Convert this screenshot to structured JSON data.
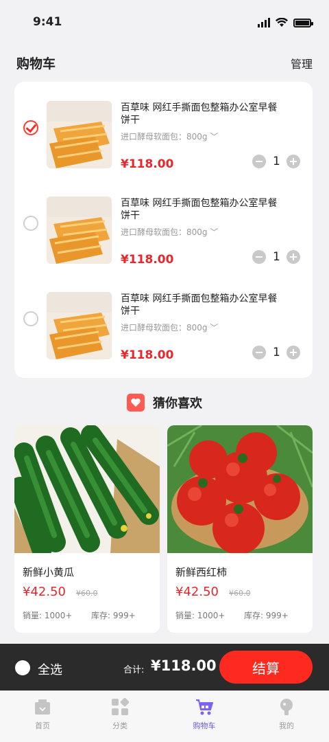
{
  "status_bar": {
    "time": "9:41"
  },
  "header": {
    "title": "购物车",
    "manage_label": "管理"
  },
  "cart": {
    "items": [
      {
        "checked": true,
        "name": "百草味 网红手撕面包整箱办公室早餐饼干",
        "spec": "进口酵母软面包：800g ﹀",
        "price": "¥118.00",
        "qty": "1"
      },
      {
        "checked": false,
        "name": "百草味 网红手撕面包整箱办公室早餐饼干",
        "spec": "进口酵母软面包：800g ﹀",
        "price": "¥118.00",
        "qty": "1"
      },
      {
        "checked": false,
        "name": "百草味 网红手撕面包整箱办公室早餐饼干",
        "spec": "进口酵母软面包：800g ﹀",
        "price": "¥118.00",
        "qty": "1"
      }
    ]
  },
  "recommend": {
    "title": "猜你喜欢",
    "icon": "heart-icon",
    "products": [
      {
        "name": "新鲜小黄瓜",
        "price": "¥42.50",
        "old_price": "¥60.0",
        "sales": "销量: 1000+",
        "stock": "库存: 999+"
      },
      {
        "name": "新鲜西红柿",
        "price": "¥42.50",
        "old_price": "¥60.0",
        "sales": "销量: 1000+",
        "stock": "库存: 999+"
      }
    ]
  },
  "checkout": {
    "select_all_label": "全选",
    "total_label": "合计:",
    "total_value": "¥118.00",
    "pay_label": "结算"
  },
  "tabbar": {
    "items": [
      {
        "label": "首页",
        "icon": "home-icon",
        "active": false
      },
      {
        "label": "分类",
        "icon": "category-icon",
        "active": false
      },
      {
        "label": "购物车",
        "icon": "cart-icon",
        "active": true
      },
      {
        "label": "我的",
        "icon": "profile-icon",
        "active": false
      }
    ]
  },
  "colors": {
    "accent": "#ff2a1f",
    "price": "#e8262b",
    "active_tab": "#6f55f0",
    "checkout_bar": "#2b2b2b"
  }
}
